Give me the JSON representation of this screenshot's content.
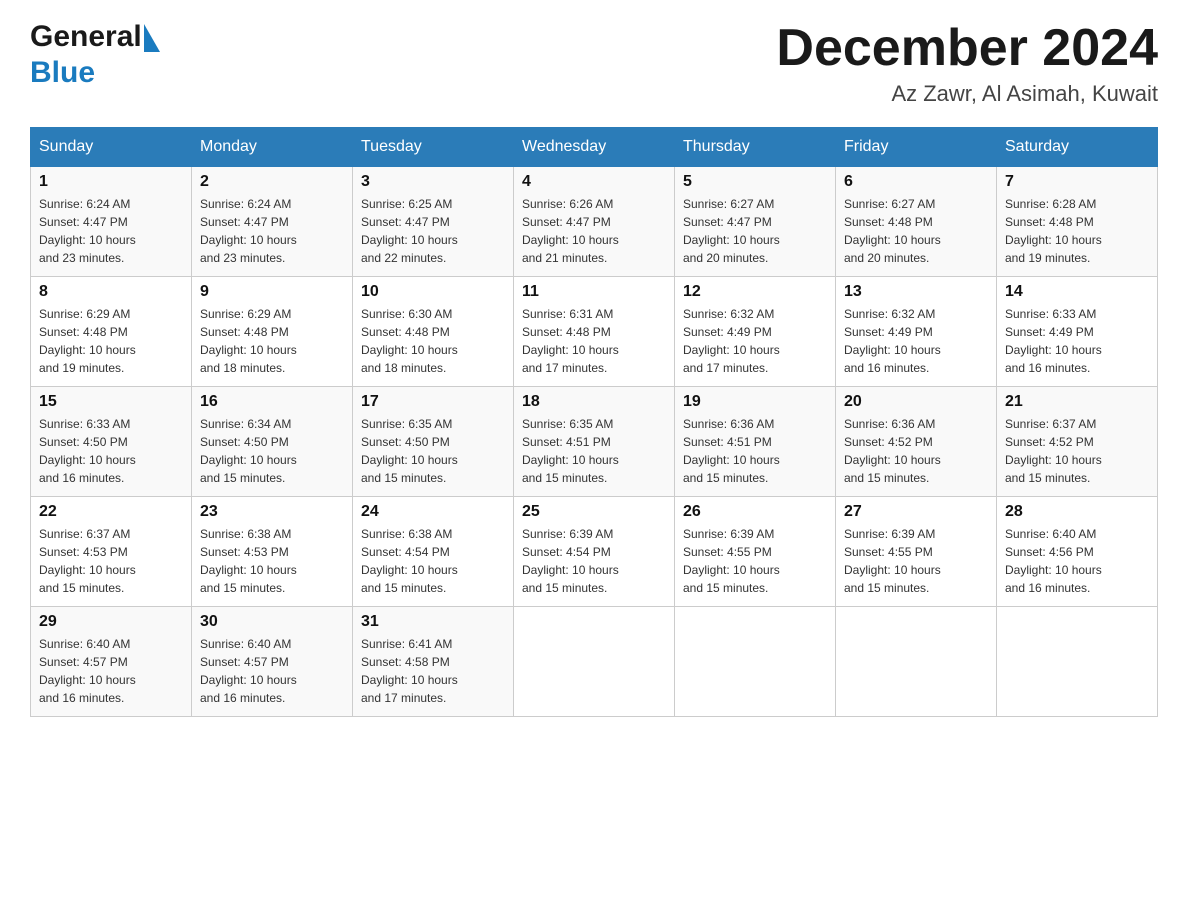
{
  "header": {
    "logo_general": "General",
    "logo_blue": "Blue",
    "month_title": "December 2024",
    "location": "Az Zawr, Al Asimah, Kuwait"
  },
  "weekdays": [
    "Sunday",
    "Monday",
    "Tuesday",
    "Wednesday",
    "Thursday",
    "Friday",
    "Saturday"
  ],
  "weeks": [
    [
      {
        "day": "1",
        "sunrise": "6:24 AM",
        "sunset": "4:47 PM",
        "daylight": "10 hours and 23 minutes."
      },
      {
        "day": "2",
        "sunrise": "6:24 AM",
        "sunset": "4:47 PM",
        "daylight": "10 hours and 23 minutes."
      },
      {
        "day": "3",
        "sunrise": "6:25 AM",
        "sunset": "4:47 PM",
        "daylight": "10 hours and 22 minutes."
      },
      {
        "day": "4",
        "sunrise": "6:26 AM",
        "sunset": "4:47 PM",
        "daylight": "10 hours and 21 minutes."
      },
      {
        "day": "5",
        "sunrise": "6:27 AM",
        "sunset": "4:47 PM",
        "daylight": "10 hours and 20 minutes."
      },
      {
        "day": "6",
        "sunrise": "6:27 AM",
        "sunset": "4:48 PM",
        "daylight": "10 hours and 20 minutes."
      },
      {
        "day": "7",
        "sunrise": "6:28 AM",
        "sunset": "4:48 PM",
        "daylight": "10 hours and 19 minutes."
      }
    ],
    [
      {
        "day": "8",
        "sunrise": "6:29 AM",
        "sunset": "4:48 PM",
        "daylight": "10 hours and 19 minutes."
      },
      {
        "day": "9",
        "sunrise": "6:29 AM",
        "sunset": "4:48 PM",
        "daylight": "10 hours and 18 minutes."
      },
      {
        "day": "10",
        "sunrise": "6:30 AM",
        "sunset": "4:48 PM",
        "daylight": "10 hours and 18 minutes."
      },
      {
        "day": "11",
        "sunrise": "6:31 AM",
        "sunset": "4:48 PM",
        "daylight": "10 hours and 17 minutes."
      },
      {
        "day": "12",
        "sunrise": "6:32 AM",
        "sunset": "4:49 PM",
        "daylight": "10 hours and 17 minutes."
      },
      {
        "day": "13",
        "sunrise": "6:32 AM",
        "sunset": "4:49 PM",
        "daylight": "10 hours and 16 minutes."
      },
      {
        "day": "14",
        "sunrise": "6:33 AM",
        "sunset": "4:49 PM",
        "daylight": "10 hours and 16 minutes."
      }
    ],
    [
      {
        "day": "15",
        "sunrise": "6:33 AM",
        "sunset": "4:50 PM",
        "daylight": "10 hours and 16 minutes."
      },
      {
        "day": "16",
        "sunrise": "6:34 AM",
        "sunset": "4:50 PM",
        "daylight": "10 hours and 15 minutes."
      },
      {
        "day": "17",
        "sunrise": "6:35 AM",
        "sunset": "4:50 PM",
        "daylight": "10 hours and 15 minutes."
      },
      {
        "day": "18",
        "sunrise": "6:35 AM",
        "sunset": "4:51 PM",
        "daylight": "10 hours and 15 minutes."
      },
      {
        "day": "19",
        "sunrise": "6:36 AM",
        "sunset": "4:51 PM",
        "daylight": "10 hours and 15 minutes."
      },
      {
        "day": "20",
        "sunrise": "6:36 AM",
        "sunset": "4:52 PM",
        "daylight": "10 hours and 15 minutes."
      },
      {
        "day": "21",
        "sunrise": "6:37 AM",
        "sunset": "4:52 PM",
        "daylight": "10 hours and 15 minutes."
      }
    ],
    [
      {
        "day": "22",
        "sunrise": "6:37 AM",
        "sunset": "4:53 PM",
        "daylight": "10 hours and 15 minutes."
      },
      {
        "day": "23",
        "sunrise": "6:38 AM",
        "sunset": "4:53 PM",
        "daylight": "10 hours and 15 minutes."
      },
      {
        "day": "24",
        "sunrise": "6:38 AM",
        "sunset": "4:54 PM",
        "daylight": "10 hours and 15 minutes."
      },
      {
        "day": "25",
        "sunrise": "6:39 AM",
        "sunset": "4:54 PM",
        "daylight": "10 hours and 15 minutes."
      },
      {
        "day": "26",
        "sunrise": "6:39 AM",
        "sunset": "4:55 PM",
        "daylight": "10 hours and 15 minutes."
      },
      {
        "day": "27",
        "sunrise": "6:39 AM",
        "sunset": "4:55 PM",
        "daylight": "10 hours and 15 minutes."
      },
      {
        "day": "28",
        "sunrise": "6:40 AM",
        "sunset": "4:56 PM",
        "daylight": "10 hours and 16 minutes."
      }
    ],
    [
      {
        "day": "29",
        "sunrise": "6:40 AM",
        "sunset": "4:57 PM",
        "daylight": "10 hours and 16 minutes."
      },
      {
        "day": "30",
        "sunrise": "6:40 AM",
        "sunset": "4:57 PM",
        "daylight": "10 hours and 16 minutes."
      },
      {
        "day": "31",
        "sunrise": "6:41 AM",
        "sunset": "4:58 PM",
        "daylight": "10 hours and 17 minutes."
      },
      null,
      null,
      null,
      null
    ]
  ],
  "labels": {
    "sunrise": "Sunrise:",
    "sunset": "Sunset:",
    "daylight": "Daylight:"
  }
}
